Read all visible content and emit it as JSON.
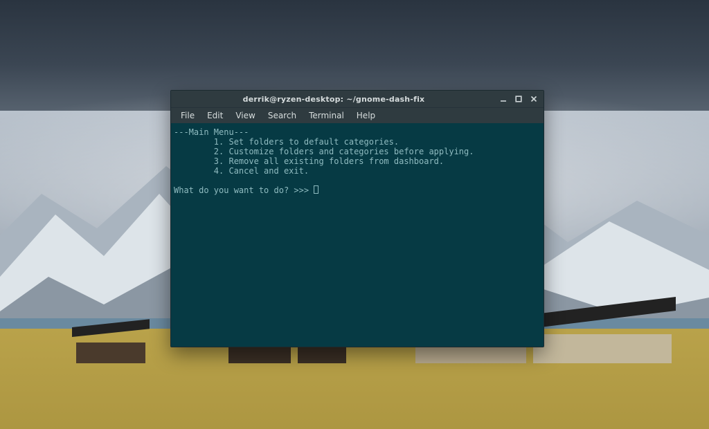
{
  "window": {
    "title": "derrik@ryzen-desktop: ~/gnome-dash-fix"
  },
  "menubar": {
    "items": [
      "File",
      "Edit",
      "View",
      "Search",
      "Terminal",
      "Help"
    ]
  },
  "terminal": {
    "menu_header": "---Main Menu---",
    "options": [
      "1. Set folders to default categories.",
      "2. Customize folders and categories before applying.",
      "3. Remove all existing folders from dashboard.",
      "4. Cancel and exit."
    ],
    "prompt": "What do you want to do? >>> "
  }
}
